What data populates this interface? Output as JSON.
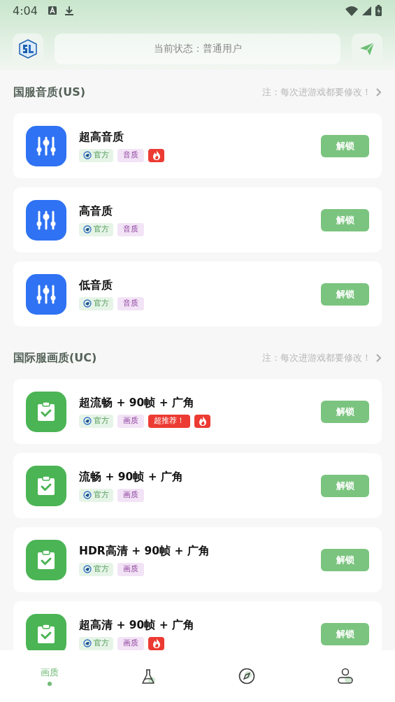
{
  "status_bar": {
    "time": "4:04"
  },
  "header": {
    "status_text": "当前状态：普通用户"
  },
  "sections": [
    {
      "title": "国服音质(US)",
      "note": "注：每次进游戏都要修改！",
      "items": [
        {
          "kind": "equalizer",
          "name": "超高音质",
          "tags": [
            {
              "kind": "official",
              "text": "官方"
            },
            {
              "kind": "category",
              "text": "音质"
            },
            {
              "kind": "hot"
            }
          ],
          "button": "解锁"
        },
        {
          "kind": "equalizer",
          "name": "高音质",
          "tags": [
            {
              "kind": "official",
              "text": "官方"
            },
            {
              "kind": "category",
              "text": "音质"
            }
          ],
          "button": "解锁"
        },
        {
          "kind": "equalizer",
          "name": "低音质",
          "tags": [
            {
              "kind": "official",
              "text": "官方"
            },
            {
              "kind": "category",
              "text": "音质"
            }
          ],
          "button": "解锁"
        }
      ]
    },
    {
      "title": "国际服画质(UC)",
      "note": "注：每次进游戏都要修改！",
      "items": [
        {
          "kind": "clipboard",
          "name": "超流畅 + 90帧 + 广角",
          "tags": [
            {
              "kind": "official",
              "text": "官方"
            },
            {
              "kind": "category",
              "text": "画质"
            },
            {
              "kind": "recommend",
              "text": "超推荐！"
            },
            {
              "kind": "hot"
            }
          ],
          "button": "解锁"
        },
        {
          "kind": "clipboard",
          "name": "流畅 + 90帧 + 广角",
          "tags": [
            {
              "kind": "official",
              "text": "官方"
            },
            {
              "kind": "category",
              "text": "画质"
            }
          ],
          "button": "解锁"
        },
        {
          "kind": "clipboard",
          "name": "HDR高清 + 90帧 + 广角",
          "tags": [
            {
              "kind": "official",
              "text": "官方"
            },
            {
              "kind": "category",
              "text": "画质"
            }
          ],
          "button": "解锁"
        },
        {
          "kind": "clipboard",
          "name": "超高清 + 90帧 + 广角",
          "tags": [
            {
              "kind": "official",
              "text": "官方"
            },
            {
              "kind": "category",
              "text": "画质"
            },
            {
              "kind": "hot"
            }
          ],
          "button": "解锁"
        }
      ]
    }
  ],
  "bottom_nav": [
    {
      "kind": "text",
      "label": "画质",
      "selected": true
    },
    {
      "kind": "flask",
      "selected": false
    },
    {
      "kind": "compass",
      "selected": false
    },
    {
      "kind": "person",
      "selected": false
    }
  ]
}
